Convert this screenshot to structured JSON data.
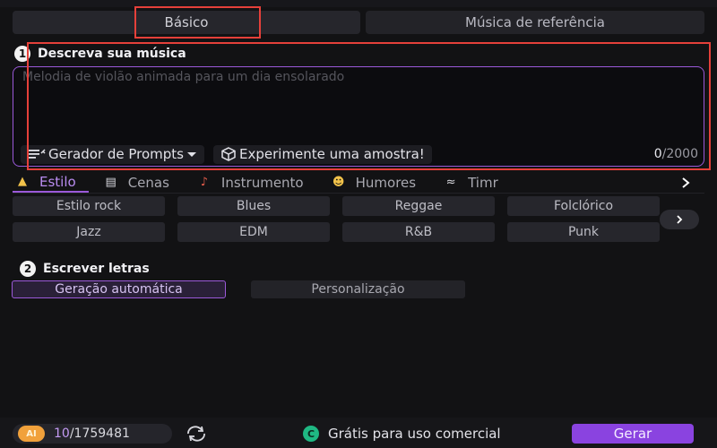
{
  "mode_tabs": [
    {
      "label": "Básico",
      "active": true
    },
    {
      "label": "Música de referência",
      "active": false
    }
  ],
  "describe_section": {
    "step": "1",
    "title": "Descreva sua música",
    "placeholder": "Melodia de violão animada para um dia ensolarado",
    "value": "",
    "prompt_generator_label": "Gerador de Prompts",
    "sample_label": "Experimente uma amostra!",
    "char_count": "0",
    "char_limit": "/2000"
  },
  "category_tabs": [
    {
      "label": "Estilo",
      "icon": "bell-icon",
      "active": true
    },
    {
      "label": "Cenas",
      "icon": "clapper-icon",
      "active": false
    },
    {
      "label": "Instrumento",
      "icon": "guitar-icon",
      "active": false
    },
    {
      "label": "Humores",
      "icon": "smiley-icon",
      "active": false
    },
    {
      "label": "Timbre",
      "icon": "wave-icon",
      "active": false
    }
  ],
  "category_tabs_overflow_label": "Timr",
  "styles": [
    "Estilo rock",
    "Blues",
    "Reggae",
    "Folclórico",
    "Jazz",
    "EDM",
    "R&B",
    "Punk"
  ],
  "lyrics_section": {
    "step": "2",
    "title": "Escrever letras",
    "options": [
      {
        "label": "Geração automática",
        "active": true
      },
      {
        "label": "Personalização",
        "active": false
      }
    ]
  },
  "footer": {
    "ai_badge": "AI",
    "credits_used": "10",
    "credits_total": "/1759481",
    "commercial_badge": "C",
    "commercial_text": "Grátis para uso comercial",
    "generate_label": "Gerar"
  },
  "colors": {
    "accent": "#9b59d9",
    "generate": "#8a43e0",
    "highlight_box": "#e5403a",
    "background": "#121214"
  }
}
